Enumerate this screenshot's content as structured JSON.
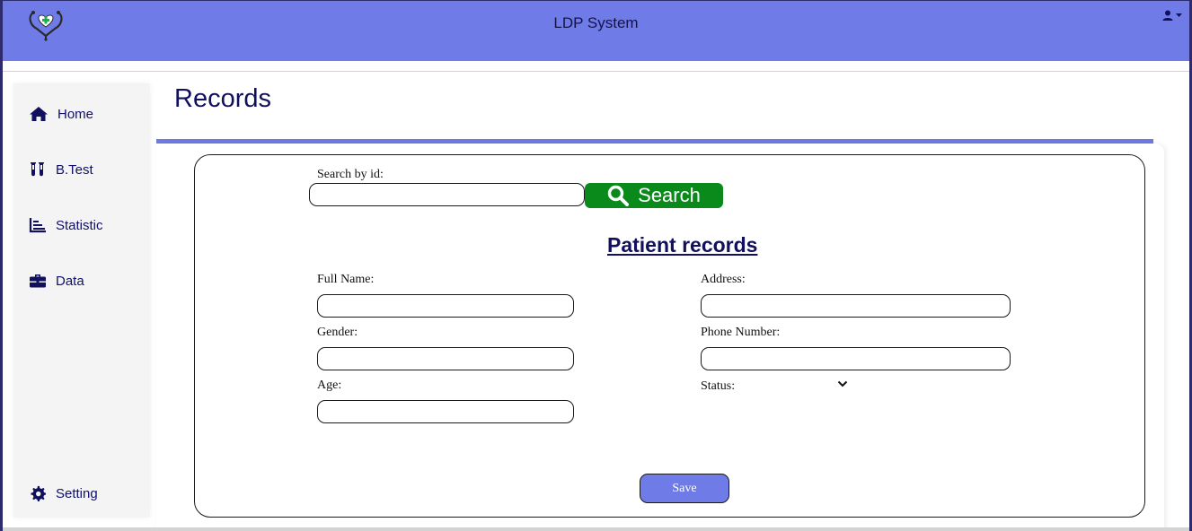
{
  "header": {
    "title": "LDP System",
    "logo_icon": "stethoscope-heart-icon",
    "user_icon": "user-icon",
    "dropdown_icon": "caret-down-icon"
  },
  "sidebar": {
    "items": [
      {
        "label": "Home",
        "icon": "home-icon"
      },
      {
        "label": "B.Test",
        "icon": "test-tubes-icon"
      },
      {
        "label": "Statistic",
        "icon": "bar-chart-icon"
      },
      {
        "label": "Data",
        "icon": "briefcase-icon"
      }
    ],
    "footer_item": {
      "label": "Setting",
      "icon": "gear-icon"
    }
  },
  "page": {
    "title": "Records"
  },
  "search": {
    "label": "Search by id:",
    "value": "",
    "button_label": "Search",
    "button_icon": "search-icon"
  },
  "form": {
    "title": "Patient records",
    "fields": {
      "full_name": {
        "label": "Full Name:",
        "value": ""
      },
      "gender": {
        "label": "Gender:",
        "value": ""
      },
      "age": {
        "label": "Age:",
        "value": ""
      },
      "address": {
        "label": "Address:",
        "value": ""
      },
      "phone_number": {
        "label": "Phone Number:",
        "value": ""
      },
      "status": {
        "label": "Status:",
        "value": ""
      }
    },
    "save_label": "Save"
  },
  "colors": {
    "primary": "#6f7be6",
    "search_button": "#0b8a1c",
    "text": "#10105e"
  }
}
